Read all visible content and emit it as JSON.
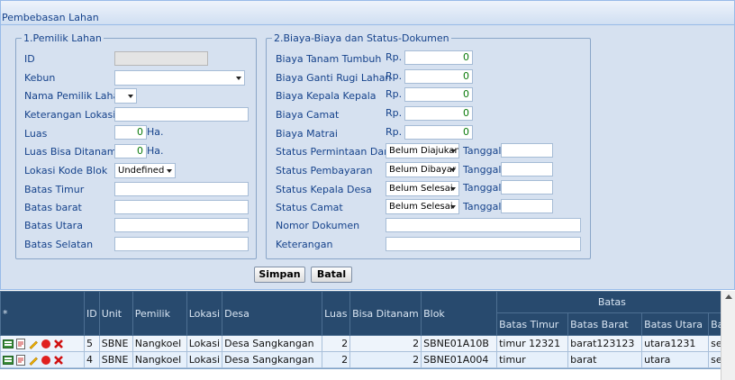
{
  "panel": {
    "title": "Pembebasan Lahan"
  },
  "pemilik": {
    "legend": "1.Pemilik Lahan",
    "id_label": "ID",
    "id_value": "",
    "kebun_label": "Kebun",
    "kebun_value": "",
    "nama_label": "Nama Pemilik Lahan",
    "nama_value": "",
    "ket_lokasi_label": "Keterangan Lokasi",
    "ket_lokasi_value": "",
    "luas_label": "Luas",
    "luas_value": "0",
    "luas_unit": "Ha.",
    "luas_bisa_label": "Luas Bisa Ditanam",
    "luas_bisa_value": "0",
    "luas_bisa_unit": "Ha.",
    "lokasi_blok_label": "Lokasi Kode Blok",
    "lokasi_blok_value": "Undefined",
    "batas_timur_label": "Batas Timur",
    "batas_timur_value": "",
    "batas_barat_label": "Batas barat",
    "batas_barat_value": "",
    "batas_utara_label": "Batas Utara",
    "batas_utara_value": "",
    "batas_selatan_label": "Batas Selatan",
    "batas_selatan_value": ""
  },
  "biaya": {
    "legend": "2.Biaya-Biaya dan Status-Dokumen",
    "currency": "Rp.",
    "tanam_label": "Biaya Tanam Tumbuh",
    "tanam_value": "0",
    "ganti_label": "Biaya Ganti Rugi Lahan",
    "ganti_value": "0",
    "kepala_label": "Biaya Kepala Kepala",
    "kepala_value": "0",
    "camat_label": "Biaya Camat",
    "camat_value": "0",
    "matrai_label": "Biaya Matrai",
    "matrai_value": "0",
    "tanggal_label": "Tanggal",
    "st_permintaan_label": "Status Permintaan Dana",
    "st_permintaan_value": "Belum Diajukan",
    "st_pembayaran_label": "Status Pembayaran",
    "st_pembayaran_value": "Belum Dibayar",
    "st_kepala_label": "Status Kepala Desa",
    "st_kepala_value": "Belum Selesai",
    "st_camat_label": "Status Camat",
    "st_camat_value": "Belum Selesai",
    "nomor_label": "Nomor Dokumen",
    "nomor_value": "",
    "keterangan_label": "Keterangan",
    "keterangan_value": ""
  },
  "buttons": {
    "simpan": "Simpan",
    "batal": "Batal"
  },
  "grid": {
    "group_header": "Batas",
    "columns": {
      "star": "*",
      "id": "ID",
      "unit": "Unit",
      "pemilik": "Pemilik",
      "lokasi": "Lokasi",
      "desa": "Desa",
      "luas": "Luas",
      "bisa": "Bisa Ditanam",
      "blok": "Blok",
      "timur": "Batas Timur",
      "barat": "Batas Barat",
      "utara": "Batas Utara",
      "selatan": "Ba"
    },
    "rows": [
      {
        "id": "5",
        "unit": "SBNE",
        "pemilik": "Nangkoel",
        "lokasi": "Lokasi",
        "desa": "Desa Sangkangan",
        "luas": "2",
        "bisa": "2",
        "blok": "SBNE01A10B",
        "timur": "timur 12321",
        "barat": "barat123123",
        "utara": "utara1231",
        "selatan": "sel"
      },
      {
        "id": "4",
        "unit": "SBNE",
        "pemilik": "Nangkoel",
        "lokasi": "Lokasi",
        "desa": "Desa Sangkangan",
        "luas": "2",
        "bisa": "2",
        "blok": "SBNE01A004",
        "timur": "timur",
        "barat": "barat",
        "utara": "utara",
        "selatan": "sel"
      }
    ]
  },
  "icons": [
    "detail-icon",
    "report-icon",
    "edit-icon",
    "record-icon",
    "delete-icon"
  ],
  "colors": {
    "header_bg": "#284a6e",
    "panel_bg": "#d6e1f0",
    "label": "#15428b",
    "number": "#0a7a0a"
  }
}
